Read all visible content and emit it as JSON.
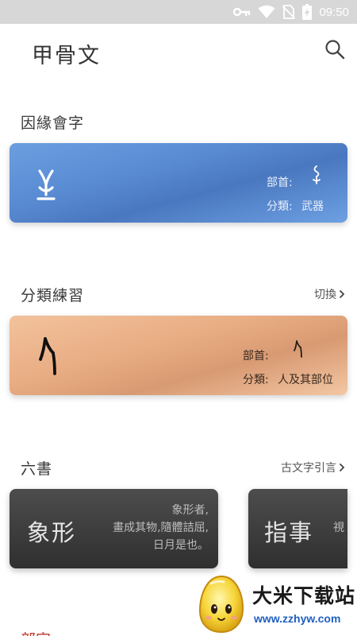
{
  "status_bar": {
    "time": "09:50",
    "icons": [
      "key-icon",
      "wifi-icon",
      "no-sim-icon",
      "battery-charging-icon"
    ]
  },
  "app_bar": {
    "title": "甲骨文",
    "search_icon": "search-icon"
  },
  "section_yuanyuan": {
    "title": "因緣會字",
    "card": {
      "radical_label": "部首:",
      "category_label": "分類:",
      "category_value": "武器",
      "accent": "#5a8cd4"
    }
  },
  "section_practice": {
    "title": "分類練習",
    "link": "切換",
    "card": {
      "radical_label": "部首:",
      "category_label": "分類:",
      "category_value": "人及其部位",
      "accent": "#e9ad84"
    }
  },
  "section_liushu": {
    "title": "六書",
    "link": "古文字引言",
    "cards": [
      {
        "name": "象形",
        "desc_lines": [
          "象形者,",
          "畫成其物,隨體詰屈,",
          "日月是也。"
        ]
      },
      {
        "name": "指事",
        "desc_lines": [
          "視"
        ]
      }
    ]
  },
  "next_section": {
    "title": "部字"
  },
  "watermark": {
    "title": "大米下载站",
    "url": "www.zzhyw.com"
  }
}
